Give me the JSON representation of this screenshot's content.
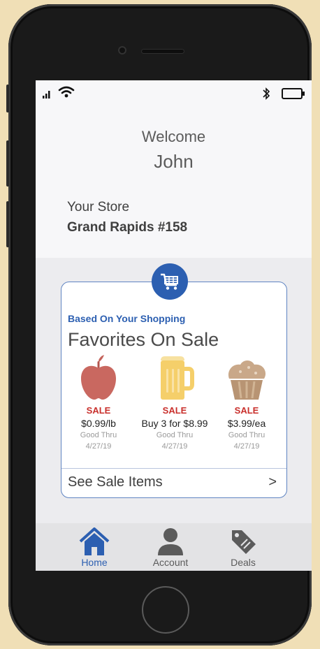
{
  "welcome": {
    "greeting": "Welcome",
    "name": "John"
  },
  "store": {
    "label": "Your Store",
    "name": "Grand Rapids #158"
  },
  "favorites": {
    "subtitle": "Based On Your Shopping",
    "title": "Favorites On Sale",
    "icon": "shopping-cart-icon",
    "items": [
      {
        "icon": "apple-icon",
        "badge": "SALE",
        "price": "$0.99/lb",
        "good_thru": "Good Thru",
        "date": "4/27/19"
      },
      {
        "icon": "beer-mug-icon",
        "badge": "SALE",
        "price": "Buy 3 for $8.99",
        "good_thru": "Good Thru",
        "date": "4/27/19"
      },
      {
        "icon": "muffin-icon",
        "badge": "SALE",
        "price": "$3.99/ea",
        "good_thru": "Good Thru",
        "date": "4/27/19"
      }
    ],
    "see_all": {
      "label": "See Sale Items",
      "arrow": ">"
    }
  },
  "tabs": [
    {
      "label": "Home",
      "icon": "home-icon",
      "active": true
    },
    {
      "label": "Account",
      "icon": "person-icon",
      "active": false
    },
    {
      "label": "Deals",
      "icon": "tag-icon",
      "active": false
    }
  ],
  "colors": {
    "accent": "#2c5fb1",
    "sale_red": "#c9302c",
    "inactive_tab": "#5b5b5b",
    "background": "#f0dfb6"
  }
}
